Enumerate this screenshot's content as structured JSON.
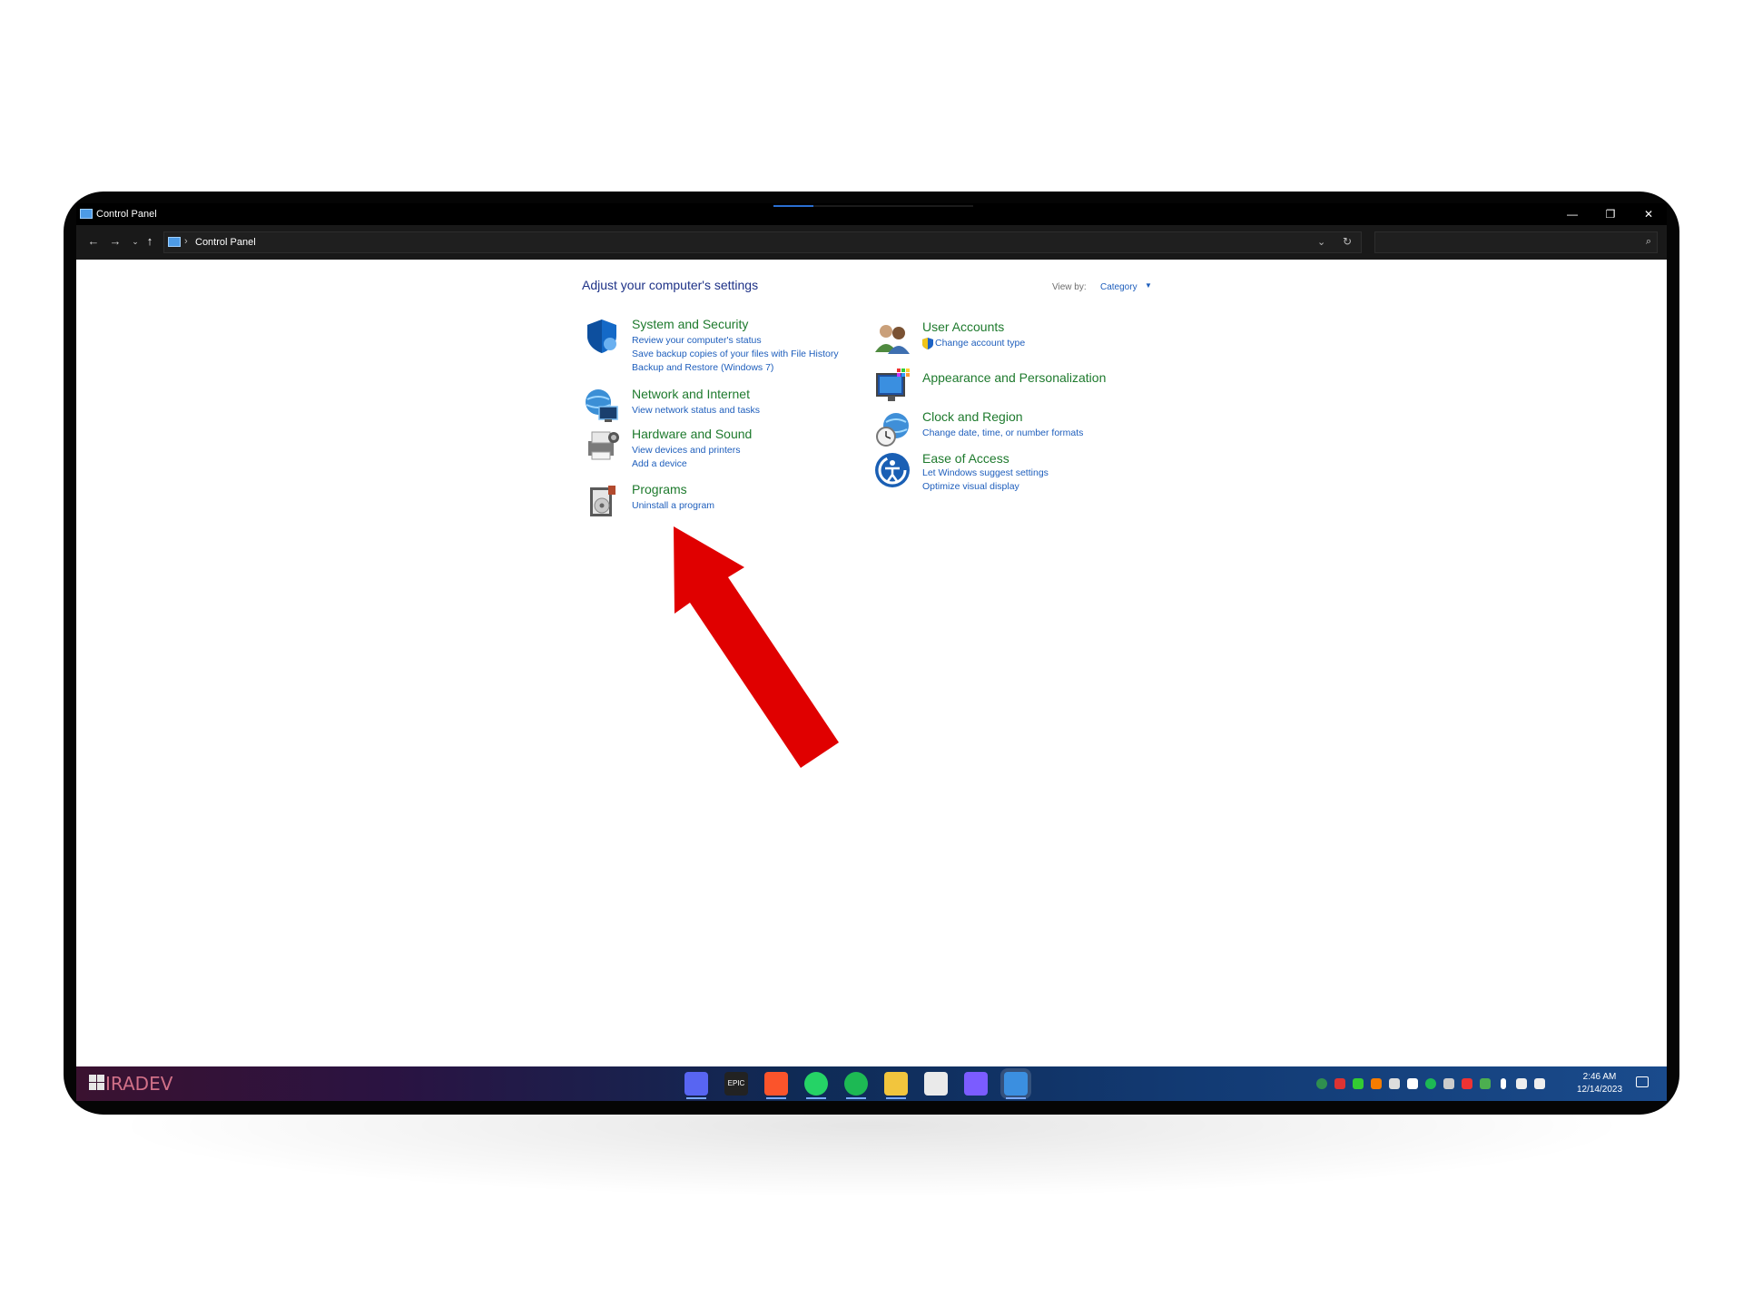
{
  "window": {
    "title": "Control Panel",
    "controls": {
      "minimize": "—",
      "maximize": "❐",
      "close": "✕"
    }
  },
  "address": {
    "back": "←",
    "forward": "→",
    "recent": "⌄",
    "up": "↑",
    "separator": "›",
    "breadcrumb": "Control Panel",
    "dropdown": "⌄",
    "refresh": "↻",
    "search_placeholder": "",
    "search_icon": "⌕"
  },
  "content": {
    "heading": "Adjust your computer's settings",
    "view_by_label": "View by:",
    "view_by_value": "Category",
    "view_by_caret": "▼",
    "left_categories": [
      {
        "title": "System and Security",
        "icon": "shield-icon",
        "links": [
          "Review your computer's status",
          "Save backup copies of your files with File History",
          "Backup and Restore (Windows 7)"
        ]
      },
      {
        "title": "Network and Internet",
        "icon": "network-icon",
        "links": [
          "View network status and tasks"
        ]
      },
      {
        "title": "Hardware and Sound",
        "icon": "printer-icon",
        "links": [
          "View devices and printers",
          "Add a device"
        ]
      },
      {
        "title": "Programs",
        "icon": "programs-icon",
        "links": [
          "Uninstall a program"
        ]
      }
    ],
    "right_categories": [
      {
        "title": "User Accounts",
        "icon": "users-icon",
        "links": [
          "Change account type"
        ]
      },
      {
        "title": "Appearance and Personalization",
        "icon": "monitor-icon",
        "links": []
      },
      {
        "title": "Clock and Region",
        "icon": "globe-clock-icon",
        "links": [
          "Change date, time, or number formats"
        ]
      },
      {
        "title": "Ease of Access",
        "icon": "ease-of-access-icon",
        "links": [
          "Let Windows suggest settings",
          "Optimize visual display"
        ]
      }
    ]
  },
  "annotation": {
    "arrow_color": "#e00000",
    "points_to": "Uninstall a program"
  },
  "taskbar": {
    "brand": "IRADEV",
    "apps": [
      "discord-icon",
      "epic-games-icon",
      "brave-icon",
      "whatsapp-icon",
      "spotify-icon",
      "file-explorer-icon",
      "microsoft-store-icon",
      "game-controller-icon",
      "control-panel-icon"
    ],
    "epic_label": "EPIC",
    "time": "2:46 AM",
    "date": "12/14/2023"
  }
}
